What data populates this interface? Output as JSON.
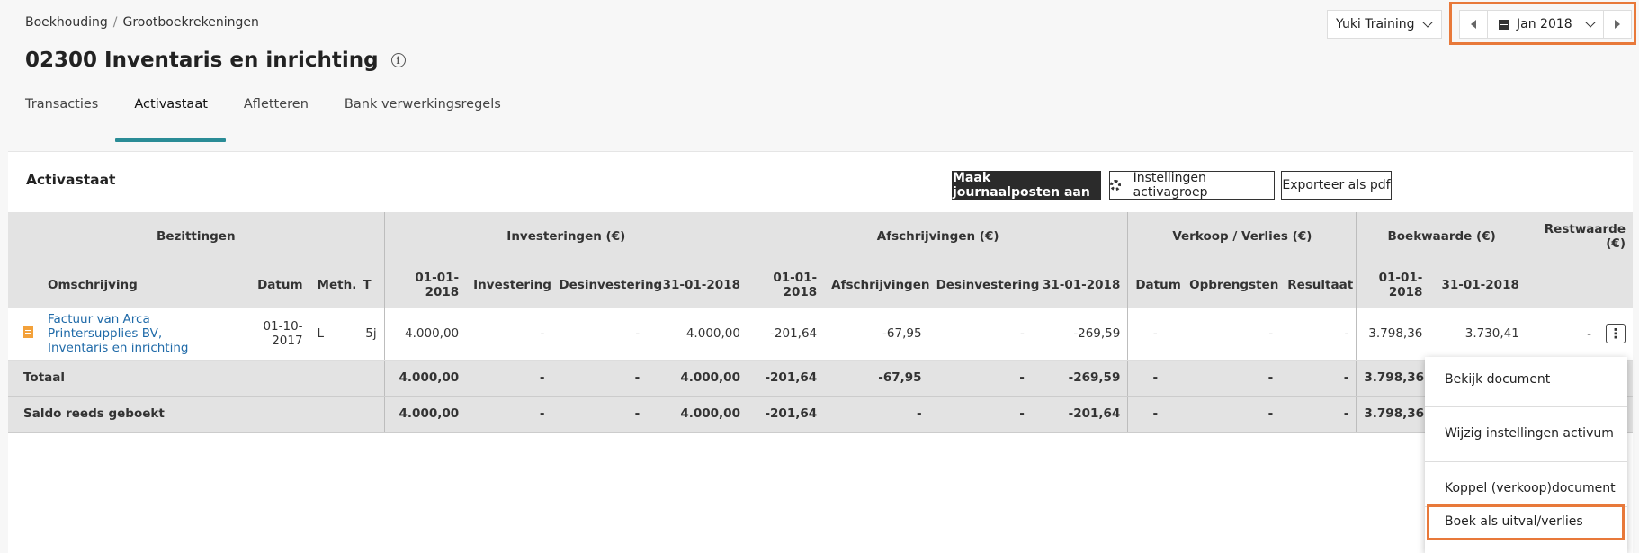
{
  "breadcrumb": {
    "items": [
      "Boekhouding",
      "Grootboekrekeningen"
    ]
  },
  "page": {
    "title": "02300 Inventaris en inrichting"
  },
  "company_select": {
    "value": "Yuki Training"
  },
  "period": {
    "value": "Jan 2018"
  },
  "tabs": [
    "Transacties",
    "Activastaat",
    "Afletteren",
    "Bank verwerkingsregels"
  ],
  "active_tab": "Activastaat",
  "card": {
    "title": "Activastaat",
    "buttons": {
      "create_journal": "Maak journaalposten aan",
      "settings_group": "Instellingen activagroep",
      "export_pdf": "Exporteer als pdf"
    }
  },
  "table": {
    "groups": {
      "bezittingen": "Bezittingen",
      "investeringen": "Investeringen (€)",
      "afschrijvingen": "Afschrijvingen (€)",
      "verkoop": "Verkoop / Verlies (€)",
      "boekwaarde": "Boekwaarde (€)",
      "restwaarde": "Restwaarde (€)"
    },
    "subheaders": {
      "omschrijving": "Omschrijving",
      "datum": "Datum",
      "meth": "Meth.",
      "t": "T",
      "inv_start": "01-01-2018",
      "investering": "Investering",
      "desinvestering": "Desinvestering",
      "inv_end": "31-01-2018",
      "afs_start": "01-01-2018",
      "afschrijvingen": "Afschrijvingen",
      "afs_desinvestering": "Desinvestering",
      "afs_end": "31-01-2018",
      "v_datum": "Datum",
      "opbrengsten": "Opbrengsten",
      "resultaat": "Resultaat",
      "bw_start": "01-01-2018",
      "bw_end": "31-01-2018"
    },
    "row": {
      "omschrijving": "Factuur van Arca Printersupplies BV, Inventaris en inrichting",
      "datum": "01-10-2017",
      "meth": "L",
      "t": "5j",
      "inv_start": "4.000,00",
      "investering": "-",
      "desinvestering": "-",
      "inv_end": "4.000,00",
      "afs_start": "-201,64",
      "afschrijvingen": "-67,95",
      "afs_desinvestering": "-",
      "afs_end": "-269,59",
      "v_datum": "-",
      "opbrengsten": "-",
      "resultaat": "-",
      "bw_start": "3.798,36",
      "bw_end": "3.730,41",
      "restwaarde": "-"
    },
    "totaal": {
      "label": "Totaal",
      "inv_start": "4.000,00",
      "investering": "-",
      "desinvestering": "-",
      "inv_end": "4.000,00",
      "afs_start": "-201,64",
      "afschrijvingen": "-67,95",
      "afs_desinvestering": "-",
      "afs_end": "-269,59",
      "v_datum": "-",
      "opbrengsten": "-",
      "resultaat": "-",
      "bw_start": "3.798,36"
    },
    "saldo": {
      "label": "Saldo reeds geboekt",
      "inv_start": "4.000,00",
      "investering": "-",
      "desinvestering": "-",
      "inv_end": "4.000,00",
      "afs_start": "-201,64",
      "afschrijvingen": "-",
      "afs_desinvestering": "-",
      "afs_end": "-201,64",
      "v_datum": "-",
      "opbrengsten": "-",
      "resultaat": "-",
      "bw_start": "3.798,36"
    }
  },
  "context_menu": {
    "items": [
      "Bekijk document",
      "Wijzig instellingen activum",
      "Koppel (verkoop)document",
      "Boek als uitval/verlies"
    ]
  },
  "colors": {
    "accent": "#2a8c96",
    "highlight": "#e8793a",
    "link": "#1f6aa8",
    "primary_button": "#2b2b2b"
  }
}
